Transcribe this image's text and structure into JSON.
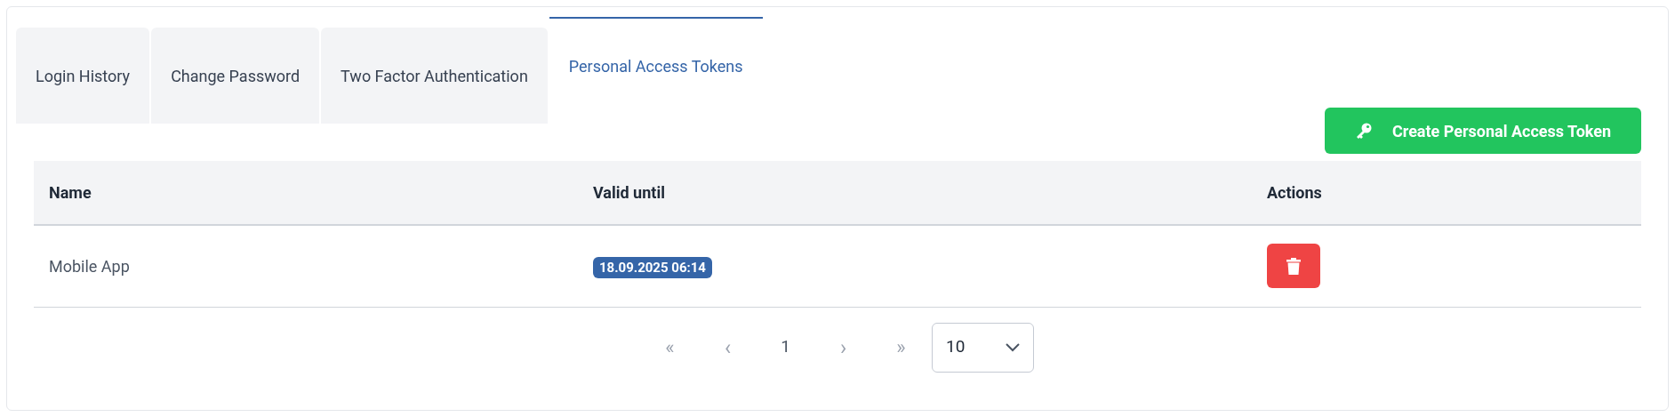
{
  "tabs": [
    {
      "label": "Login History",
      "selected": false
    },
    {
      "label": "Change Password",
      "selected": false
    },
    {
      "label": "Two Factor Authentication",
      "selected": false
    },
    {
      "label": "Personal Access Tokens",
      "selected": true
    }
  ],
  "create_button": {
    "label": "Create Personal Access Token"
  },
  "table": {
    "columns": [
      "Name",
      "Valid until",
      "Actions"
    ],
    "rows": [
      {
        "name": "Mobile App",
        "valid_until": "18.09.2025 06:14"
      }
    ]
  },
  "pagination": {
    "first": "«",
    "previous": "‹",
    "pages": [
      {
        "label": "1",
        "selected": true
      }
    ],
    "next": "›",
    "last": "»",
    "page_size": "10"
  }
}
